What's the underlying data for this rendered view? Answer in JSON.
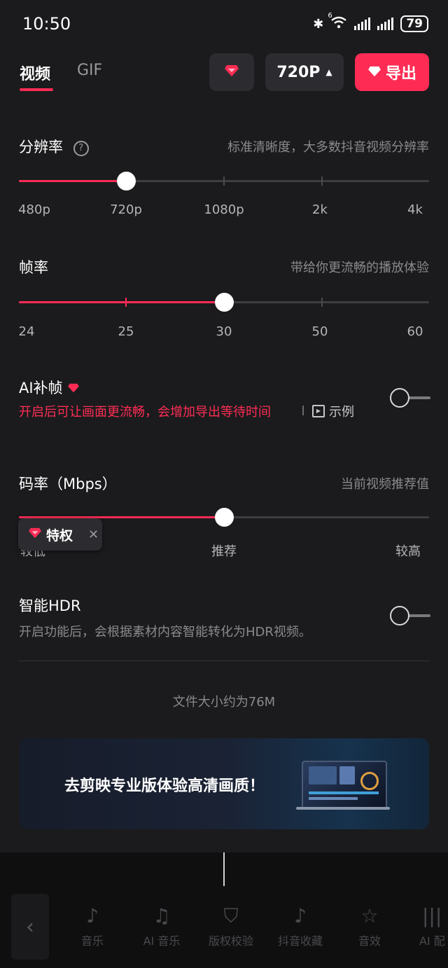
{
  "status": {
    "time": "10:50",
    "battery": "79",
    "wifi_badge": "6"
  },
  "tabs": [
    {
      "label": "视频"
    },
    {
      "label": "GIF"
    }
  ],
  "toolbar": {
    "resolution_label": "720P",
    "export_label": "导出"
  },
  "resolution": {
    "title": "分辨率",
    "desc": "标准清晰度，大多数抖音视频分辨率",
    "ticks": [
      "480p",
      "720p",
      "1080p",
      "2k",
      "4k"
    ],
    "selected": "720p"
  },
  "framerate": {
    "title": "帧率",
    "desc": "带给你更流畅的播放体验",
    "ticks": [
      "24",
      "25",
      "30",
      "50",
      "60"
    ],
    "selected": "30"
  },
  "ai_frame": {
    "title": "AI补帧",
    "desc": "开启后可让画面更流畅，会增加导出等待时间",
    "example_label": "示例",
    "enabled": false
  },
  "bitrate": {
    "title": "码率（Mbps）",
    "desc": "当前视频推荐值",
    "ticks": [
      "较低",
      "推荐",
      "较高"
    ],
    "selected": "推荐",
    "privilege_badge": "特权"
  },
  "hdr": {
    "title": "智能HDR",
    "desc": "开启功能后，会根据素材内容智能转化为HDR视频。",
    "enabled": false
  },
  "file_size": "文件大小约为76M",
  "banner": {
    "text": "去剪映专业版体验高清画质！"
  },
  "bottom_tools": [
    {
      "label": "音乐",
      "icon": "music-note-icon"
    },
    {
      "label": "AI 音乐",
      "icon": "ai-music-icon"
    },
    {
      "label": "版权校验",
      "icon": "copyright-shield-icon"
    },
    {
      "label": "抖音收藏",
      "icon": "douyin-icon"
    },
    {
      "label": "音效",
      "icon": "star-sfx-icon"
    },
    {
      "label": "AI 配",
      "icon": "waveform-icon"
    }
  ],
  "colors": {
    "accent": "#fe2c55",
    "background": "#1b1b1d"
  }
}
